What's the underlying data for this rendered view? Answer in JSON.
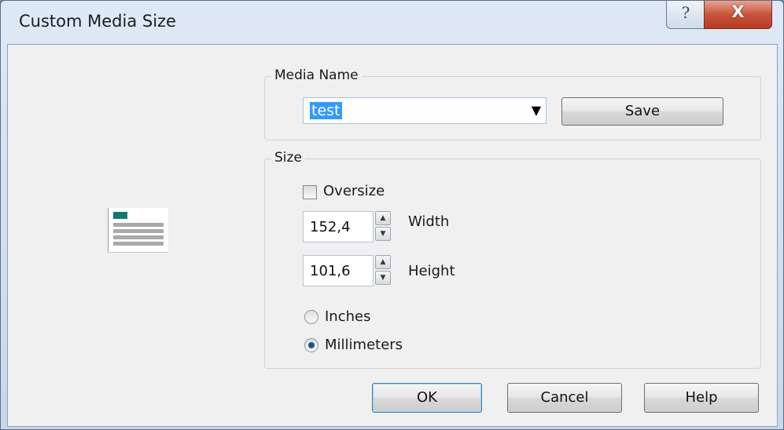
{
  "window": {
    "title": "Custom Media Size",
    "help_glyph": "?",
    "close_glyph": "X"
  },
  "media_name": {
    "group_label": "Media Name",
    "selected_value": "test",
    "dropdown_arrow": "▼",
    "save_label": "Save"
  },
  "size": {
    "group_label": "Size",
    "oversize_label": "Oversize",
    "oversize_checked": false,
    "width_value": "152,4",
    "width_label": "Width",
    "height_value": "101,6",
    "height_label": "Height",
    "units": [
      {
        "label": "Inches",
        "selected": false
      },
      {
        "label": "Millimeters",
        "selected": true
      }
    ],
    "spin_up": "▲",
    "spin_down": "▼"
  },
  "buttons": {
    "ok": "OK",
    "cancel": "Cancel",
    "help": "Help"
  },
  "colors": {
    "selection": "#3399ff",
    "preview_swatch": "#0f7a73"
  }
}
